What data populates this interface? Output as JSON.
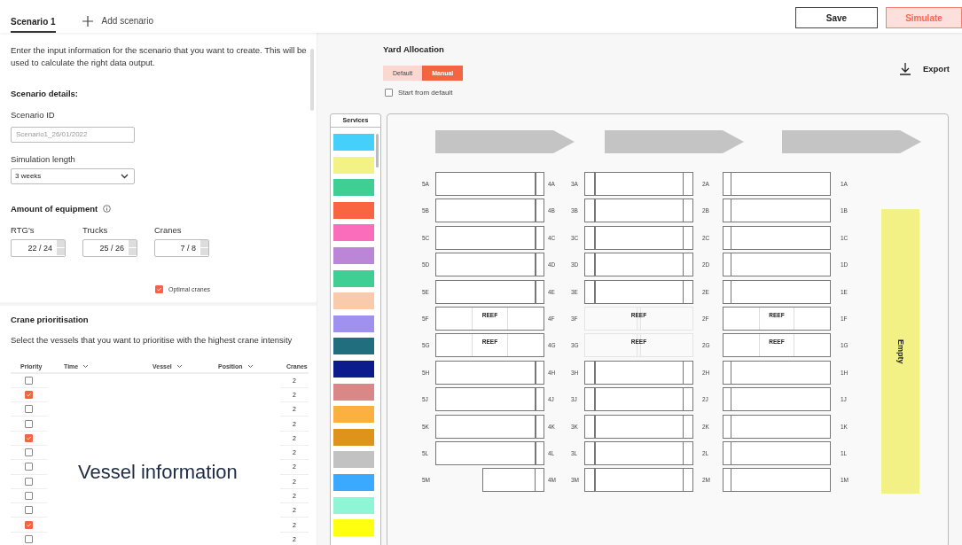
{
  "tabs": [
    {
      "label": "Scenario 1",
      "selected": true
    }
  ],
  "add_tab": {
    "label": "Add scenario"
  },
  "actions": [
    {
      "label": "Save",
      "kind": "secondary"
    },
    {
      "label": "Simulate",
      "kind": "primary"
    }
  ],
  "intro": "Enter the input information for the scenario that you want to create. This will be used to calculate the right data output.",
  "scenario_details": {
    "title": "Scenario details:",
    "scenario_id": {
      "label": "Scenario ID",
      "placeholder": "Scenario1_26/01/2022"
    },
    "simulation_length": {
      "label": "Simulation length",
      "value": "3 weeks"
    }
  },
  "equipment": {
    "title": "Amount of equipment",
    "fields": [
      {
        "label": "RTG's",
        "value": "22 / 24"
      },
      {
        "label": "Trucks",
        "value": "25 / 26"
      },
      {
        "label": "Cranes",
        "value": "7 / 8"
      }
    ],
    "optimal_cranes": {
      "label": "Optimal cranes",
      "checked": true
    }
  },
  "crane_prioritisation": {
    "title": "Crane prioritisation",
    "description": "Select the vessels that you want to prioritise with the highest crane intensity",
    "columns": [
      {
        "label": "Priority",
        "sortable": false
      },
      {
        "label": "Time",
        "sortable": true
      },
      {
        "label": "Vessel",
        "sortable": true
      },
      {
        "label": "Position",
        "sortable": true
      },
      {
        "label": "Cranes",
        "sortable": false
      }
    ],
    "rows": [
      {
        "checked": false,
        "cranes": "2"
      },
      {
        "checked": true,
        "cranes": "2"
      },
      {
        "checked": false,
        "cranes": "2"
      },
      {
        "checked": false,
        "cranes": "2"
      },
      {
        "checked": true,
        "cranes": "2"
      },
      {
        "checked": false,
        "cranes": "2"
      },
      {
        "checked": false,
        "cranes": "2"
      },
      {
        "checked": false,
        "cranes": "2"
      },
      {
        "checked": false,
        "cranes": "2"
      },
      {
        "checked": false,
        "cranes": "2"
      },
      {
        "checked": true,
        "cranes": "2"
      },
      {
        "checked": false,
        "cranes": "2"
      }
    ],
    "overlay": "Vessel information"
  },
  "yard": {
    "title": "Yard Allocation",
    "modes": [
      {
        "label": "Default",
        "selected": false
      },
      {
        "label": "Manual",
        "selected": true
      }
    ],
    "export": "Export",
    "start_from_default": {
      "label": "Start from default",
      "checked": false
    },
    "services": {
      "title": "Services",
      "items": [
        {
          "color": "#45d0fb"
        },
        {
          "color": "#f2f286"
        },
        {
          "color": "#3fcf94"
        },
        {
          "color": "#f96541"
        },
        {
          "color": "#f96dba"
        },
        {
          "color": "#bc86d8"
        },
        {
          "color": "#3fcf94"
        },
        {
          "color": "#f9cbaa"
        },
        {
          "color": "#a090f0"
        },
        {
          "color": "#216e7e"
        },
        {
          "color": "#0c1c8c"
        },
        {
          "color": "#d98787"
        },
        {
          "color": "#fbb040"
        },
        {
          "color": "#e0931a"
        },
        {
          "color": "#c2c2c2"
        },
        {
          "color": "#3aa9ff"
        },
        {
          "color": "#8ff5d4"
        },
        {
          "color": "#ffff10"
        }
      ]
    },
    "rows": [
      {
        "labels": [
          "5A",
          "4A",
          "3A",
          "2A",
          "1A"
        ],
        "blocks": [
          {
            "kind": "stack"
          },
          {
            "kind": "stack"
          },
          {
            "kind": "stack"
          }
        ]
      },
      {
        "labels": [
          "5B",
          "4B",
          "3B",
          "2B",
          "1B"
        ],
        "blocks": [
          {
            "kind": "stack"
          },
          {
            "kind": "stack"
          },
          {
            "kind": "stack"
          }
        ]
      },
      {
        "labels": [
          "5C",
          "4C",
          "3C",
          "2C",
          "1C"
        ],
        "blocks": [
          {
            "kind": "stack"
          },
          {
            "kind": "stack"
          },
          {
            "kind": "stack"
          }
        ]
      },
      {
        "labels": [
          "5D",
          "4D",
          "3D",
          "2D",
          "1D"
        ],
        "blocks": [
          {
            "kind": "stack"
          },
          {
            "kind": "stack"
          },
          {
            "kind": "stack"
          }
        ]
      },
      {
        "labels": [
          "5E",
          "4E",
          "3E",
          "2E",
          "1E"
        ],
        "blocks": [
          {
            "kind": "stack"
          },
          {
            "kind": "stack"
          },
          {
            "kind": "stack"
          }
        ]
      },
      {
        "labels": [
          "5F",
          "4F",
          "3F",
          "2F",
          "1F"
        ],
        "blocks": [
          {
            "kind": "reef",
            "text": "REEF"
          },
          {
            "kind": "reef-faded",
            "text": "REEF"
          },
          {
            "kind": "reef",
            "text": "REEF"
          }
        ]
      },
      {
        "labels": [
          "5G",
          "4G",
          "3G",
          "2G",
          "1G"
        ],
        "blocks": [
          {
            "kind": "reef",
            "text": "REEF"
          },
          {
            "kind": "reef-faded",
            "text": "REEF"
          },
          {
            "kind": "reef",
            "text": "REEF"
          }
        ]
      },
      {
        "labels": [
          "5H",
          "4H",
          "3H",
          "2H",
          "1H"
        ],
        "blocks": [
          {
            "kind": "stack"
          },
          {
            "kind": "stack"
          },
          {
            "kind": "stack"
          }
        ]
      },
      {
        "labels": [
          "5J",
          "4J",
          "3J",
          "2J",
          "1J"
        ],
        "blocks": [
          {
            "kind": "stack"
          },
          {
            "kind": "stack"
          },
          {
            "kind": "stack"
          }
        ]
      },
      {
        "labels": [
          "5K",
          "4K",
          "3K",
          "2K",
          "1K"
        ],
        "blocks": [
          {
            "kind": "stack"
          },
          {
            "kind": "stack"
          },
          {
            "kind": "stack"
          }
        ]
      },
      {
        "labels": [
          "5L",
          "4L",
          "3L",
          "2L",
          "1L"
        ],
        "blocks": [
          {
            "kind": "stack"
          },
          {
            "kind": "stack"
          },
          {
            "kind": "stack"
          }
        ]
      },
      {
        "labels": [
          "5M",
          "4M",
          "3M",
          "2M",
          "1M"
        ],
        "blocks": [
          {
            "kind": "stack-short"
          },
          {
            "kind": "stack"
          },
          {
            "kind": "stack"
          }
        ]
      }
    ],
    "empty_lane": {
      "label": "Empty"
    }
  }
}
